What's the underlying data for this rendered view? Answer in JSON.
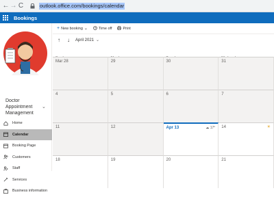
{
  "browser": {
    "url": "outlook.office.com/bookings/calendar",
    "back_icon": "arrow-left-icon",
    "forward_icon": "arrow-right-icon",
    "lock_icon": "lock-icon"
  },
  "app": {
    "title": "Bookings",
    "accent": "#0f6cbd"
  },
  "sidebar": {
    "business_name": "Doctor Appointment Management",
    "items": [
      {
        "label": "Home",
        "icon": "home-icon",
        "selected": false
      },
      {
        "label": "Calendar",
        "icon": "calendar-icon",
        "selected": true
      },
      {
        "label": "Booking Page",
        "icon": "booking-page-icon",
        "selected": false
      },
      {
        "label": "Customers",
        "icon": "customers-icon",
        "selected": false
      },
      {
        "label": "Staff",
        "icon": "staff-icon",
        "selected": false
      },
      {
        "label": "Services",
        "icon": "services-icon",
        "selected": false
      },
      {
        "label": "Business information",
        "icon": "business-info-icon",
        "selected": false
      }
    ]
  },
  "toolbar": {
    "new_booking": "New booking",
    "time_off": "Time off",
    "print": "Print"
  },
  "calendar": {
    "month_label": "April 2021",
    "day_headers": [
      "Sunday",
      "Monday",
      "Tuesday",
      "Wednesday"
    ],
    "weeks": [
      [
        "Mar 28",
        "29",
        "30",
        "31"
      ],
      [
        "4",
        "5",
        "6",
        "7"
      ],
      [
        "11",
        "12",
        "Apr 13",
        "14"
      ],
      [
        "18",
        "19",
        "20",
        "21"
      ]
    ],
    "today_weather": "17°"
  }
}
